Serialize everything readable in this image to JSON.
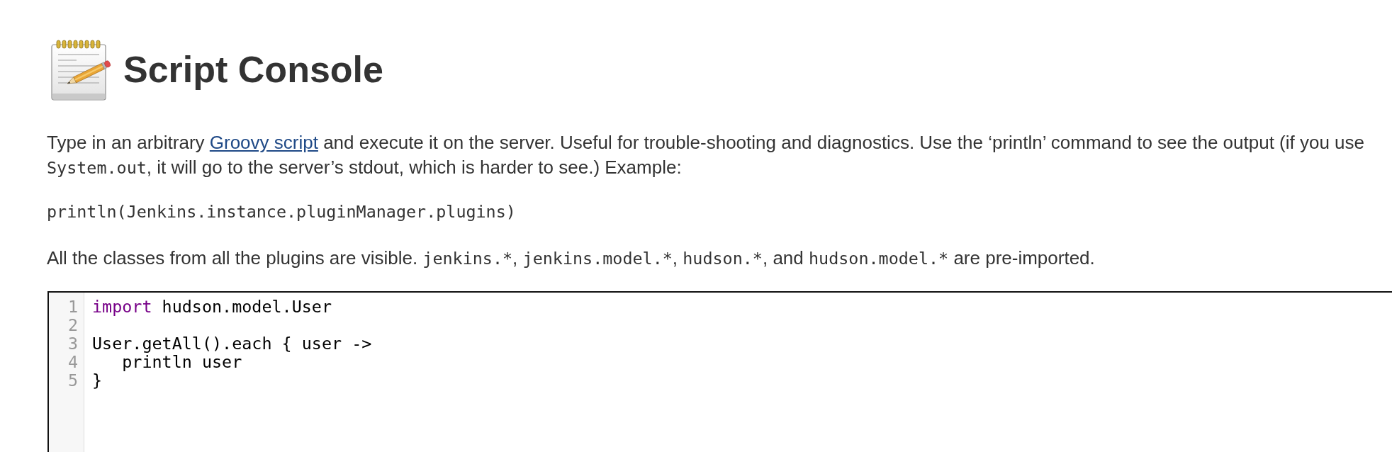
{
  "header": {
    "title": "Script Console"
  },
  "description": {
    "segments": [
      {
        "kind": "text",
        "text": "Type in an arbitrary "
      },
      {
        "kind": "link",
        "text": "Groovy script"
      },
      {
        "kind": "text",
        "text": " and execute it on the server. Useful for trouble-shooting and diagnostics. Use the ‘println’ command to see the output (if you use "
      },
      {
        "kind": "code",
        "text": "System.out"
      },
      {
        "kind": "text",
        "text": ", it will go to the server’s stdout, which is harder to see.) Example:"
      }
    ]
  },
  "example": {
    "code": "println(Jenkins.instance.pluginManager.plugins)"
  },
  "note": {
    "lead": "All the classes from all the plugins are visible. ",
    "packages": [
      {
        "code": "jenkins.*",
        "after": ", "
      },
      {
        "code": "jenkins.model.*",
        "after": ", "
      },
      {
        "code": "hudson.*",
        "after": ", and "
      },
      {
        "code": "hudson.model.*",
        "after": " are pre-imported."
      }
    ]
  },
  "editor": {
    "lines": [
      {
        "number": "1",
        "tokens": [
          {
            "kind": "keyword",
            "text": "import"
          },
          {
            "kind": "plain",
            "text": " hudson.model.User"
          }
        ]
      },
      {
        "number": "2"
      },
      {
        "number": "3",
        "tokens": [
          {
            "kind": "plain",
            "text": "User.getAll().each { user ->"
          }
        ]
      },
      {
        "number": "4",
        "tokens": [
          {
            "kind": "plain",
            "text": "   println user"
          }
        ]
      },
      {
        "number": "5",
        "tokens": [
          {
            "kind": "plain",
            "text": "}"
          }
        ]
      }
    ]
  }
}
